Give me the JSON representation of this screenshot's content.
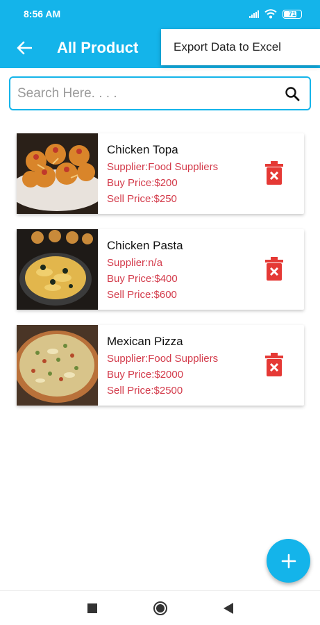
{
  "status_bar": {
    "time": "8:56 AM",
    "battery": "71"
  },
  "app_bar": {
    "title": "All Product",
    "background": "#14b4ea"
  },
  "menu": {
    "export_label": "Export Data to Excel"
  },
  "search": {
    "placeholder": "Search Here. . . .",
    "value": ""
  },
  "products": [
    {
      "name": "Chicken Topa",
      "supplier": "Supplier:Food Suppliers",
      "buy_price": "Buy Price:$200",
      "sell_price": "Sell Price:$250"
    },
    {
      "name": "Chicken Pasta",
      "supplier": "Supplier:n/a",
      "buy_price": "Buy Price:$400",
      "sell_price": "Sell Price:$600"
    },
    {
      "name": "Mexican Pizza",
      "supplier": "Supplier:Food Suppliers",
      "buy_price": "Buy Price:$2000",
      "sell_price": "Sell Price:$2500"
    }
  ],
  "icons": {
    "back": "arrow-left-icon",
    "search": "search-icon",
    "delete": "trash-icon",
    "add": "plus-icon"
  },
  "colors": {
    "accent": "#14b4ea",
    "price_text": "#d33a4a",
    "delete": "#e53935"
  }
}
